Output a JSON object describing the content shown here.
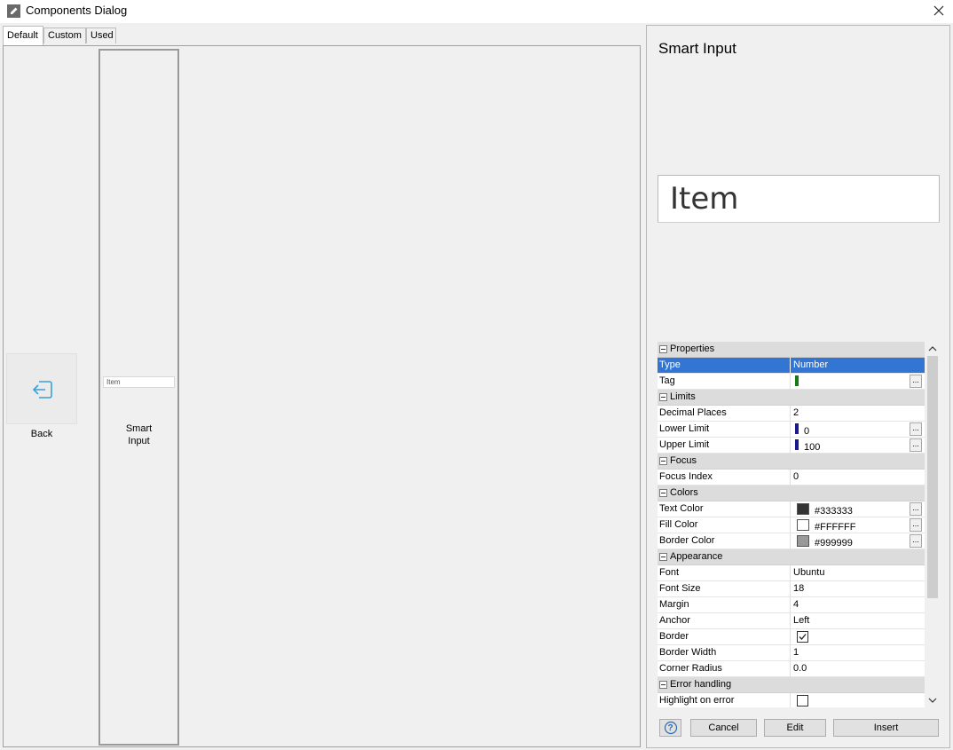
{
  "window": {
    "title": "Components Dialog"
  },
  "tabs": [
    {
      "label": "Default",
      "active": true
    },
    {
      "label": "Custom",
      "active": false
    },
    {
      "label": "Used",
      "active": false
    }
  ],
  "left": {
    "back_label": "Back",
    "smart_input": {
      "preview_text": "Item",
      "label_line1": "Smart",
      "label_line2": "Input"
    }
  },
  "panel": {
    "title": "Smart Input",
    "preview_text": "Item"
  },
  "properties": {
    "cat_properties": "Properties",
    "type_k": "Type",
    "type_v": "Number",
    "tag_k": "Tag",
    "cat_limits": "Limits",
    "decimal_k": "Decimal Places",
    "decimal_v": "2",
    "lower_k": "Lower Limit",
    "lower_v": "0",
    "upper_k": "Upper Limit",
    "upper_v": "100",
    "cat_focus": "Focus",
    "focus_index_k": "Focus Index",
    "focus_index_v": "0",
    "cat_colors": "Colors",
    "text_color_k": "Text Color",
    "text_color_v": "#333333",
    "fill_color_k": "Fill Color",
    "fill_color_v": "#FFFFFF",
    "border_color_k": "Border Color",
    "border_color_v": "#999999",
    "cat_appearance": "Appearance",
    "font_k": "Font",
    "font_v": "Ubuntu",
    "font_size_k": "Font Size",
    "font_size_v": "18",
    "margin_k": "Margin",
    "margin_v": "4",
    "anchor_k": "Anchor",
    "anchor_v": "Left",
    "border_k": "Border",
    "border_checked": true,
    "border_width_k": "Border Width",
    "border_width_v": "1",
    "corner_radius_k": "Corner Radius",
    "corner_radius_v": "0.0",
    "cat_error": "Error handling",
    "highlight_k": "Highlight on error",
    "highlight_checked": false,
    "ellipsis": "..."
  },
  "colors": {
    "selection": "#3375d3",
    "tag_bar": "#1a7a1a",
    "limit_bar": "#1a1a8c",
    "text_color_swatch": "#333333",
    "fill_color_swatch": "#FFFFFF",
    "border_color_swatch": "#999999",
    "back_icon": "#3aa0d8"
  },
  "buttons": {
    "help": "?",
    "cancel": "Cancel",
    "edit": "Edit",
    "insert": "Insert"
  }
}
